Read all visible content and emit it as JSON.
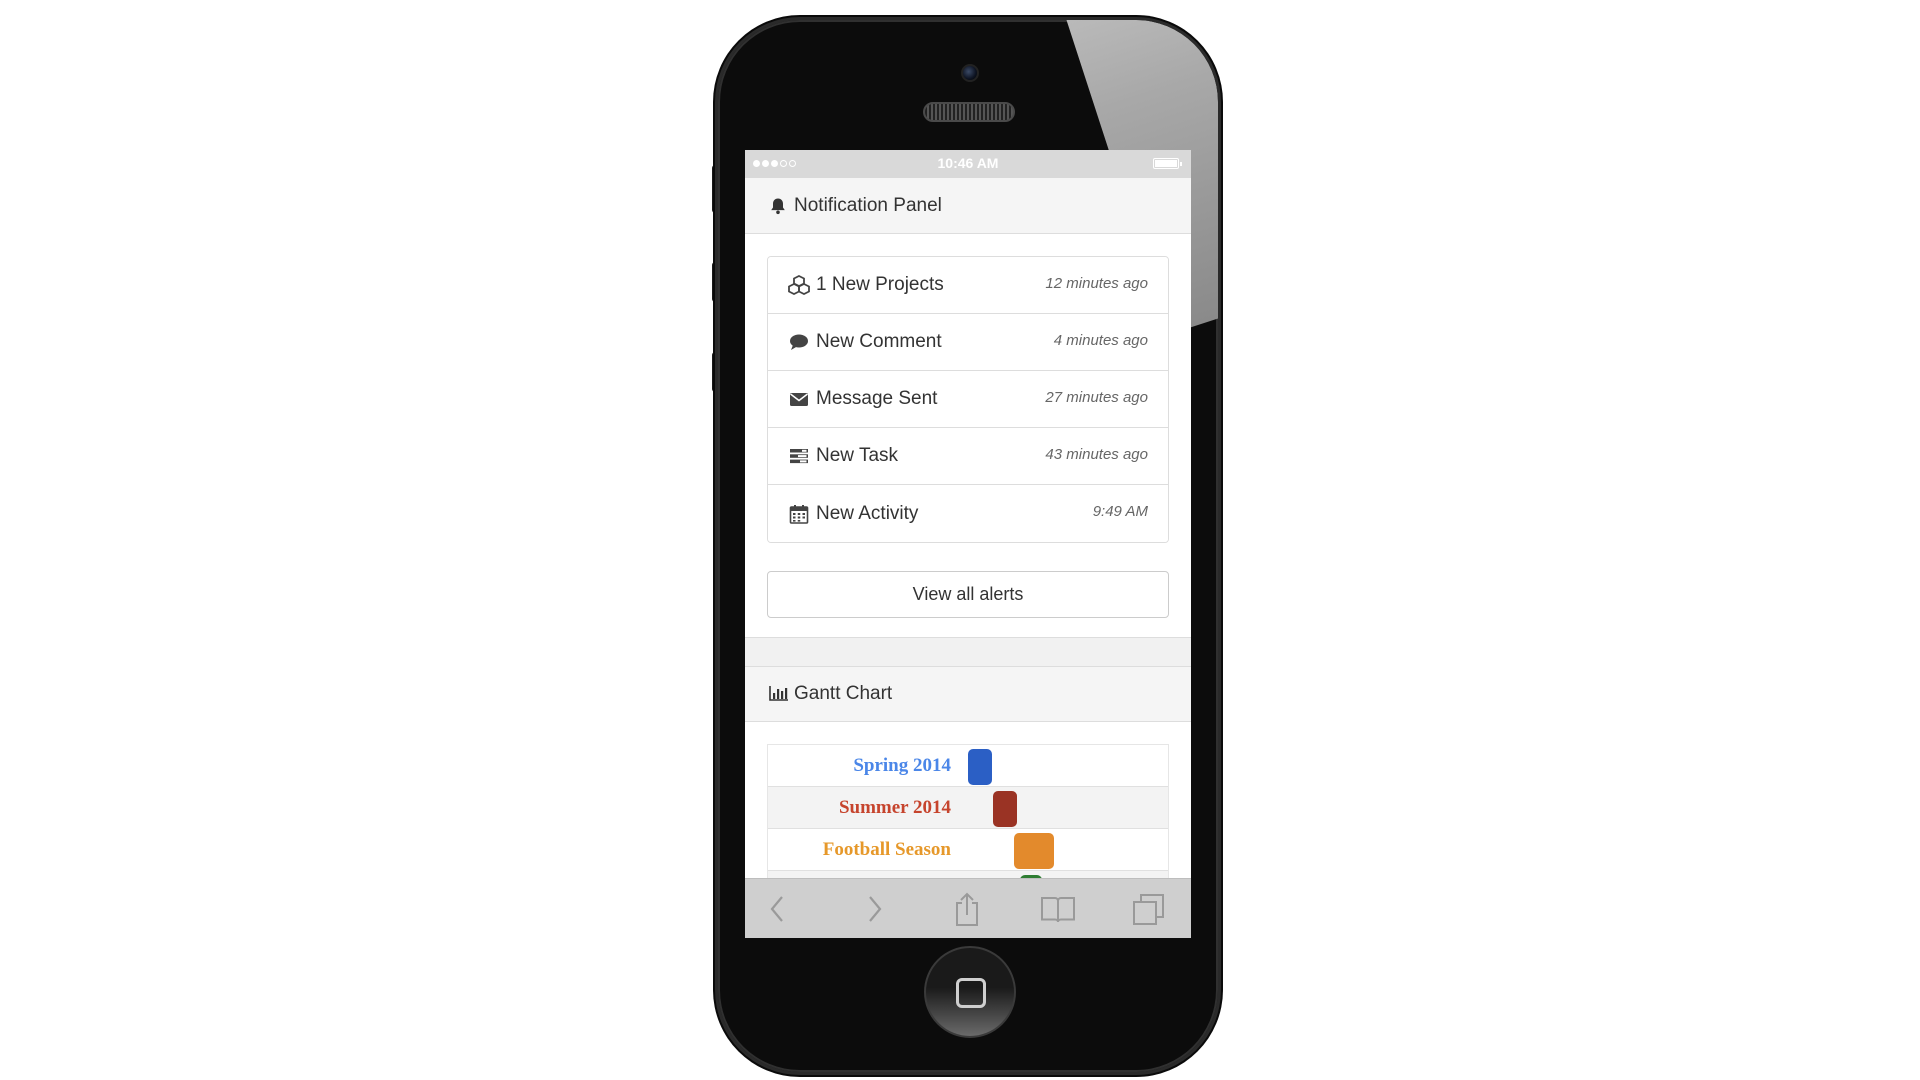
{
  "status_bar": {
    "time": "10:46 AM"
  },
  "notification_panel": {
    "title": "Notification Panel",
    "icon": "bell-icon",
    "items": [
      {
        "icon": "cubes-icon",
        "label": "1 New Projects",
        "time": "12 minutes ago"
      },
      {
        "icon": "comment-icon",
        "label": "New Comment",
        "time": "4 minutes ago"
      },
      {
        "icon": "envelope-icon",
        "label": "Message Sent",
        "time": "27 minutes ago"
      },
      {
        "icon": "tasks-icon",
        "label": "New Task",
        "time": "43 minutes ago"
      },
      {
        "icon": "calendar-icon",
        "label": "New Activity",
        "time": "9:49 AM"
      }
    ],
    "view_all_label": "View all alerts"
  },
  "gantt_panel": {
    "title": "Gantt Chart",
    "icon": "bar-chart-icon"
  },
  "chart_data": {
    "type": "gantt",
    "rows": [
      {
        "label": "Spring 2014",
        "color": "#2a5fc5",
        "bar_color": "#2b5fc5",
        "label_color": "#4a86e8"
      },
      {
        "label": "Summer 2014",
        "color": "#c6442d",
        "bar_color": "#9a3324",
        "label_color": "#c6442d"
      },
      {
        "label": "Football Season",
        "color": "#e6982a",
        "bar_color": "#e38a2c",
        "label_color": "#e6982a"
      },
      {
        "label": "",
        "color": "#2e7d32",
        "bar_color": "#2e7d32",
        "label_color": "#2e7d32"
      }
    ]
  },
  "browser_toolbar": {
    "buttons": [
      "back-icon",
      "forward-icon",
      "share-icon",
      "bookmarks-icon",
      "tabs-icon"
    ]
  }
}
